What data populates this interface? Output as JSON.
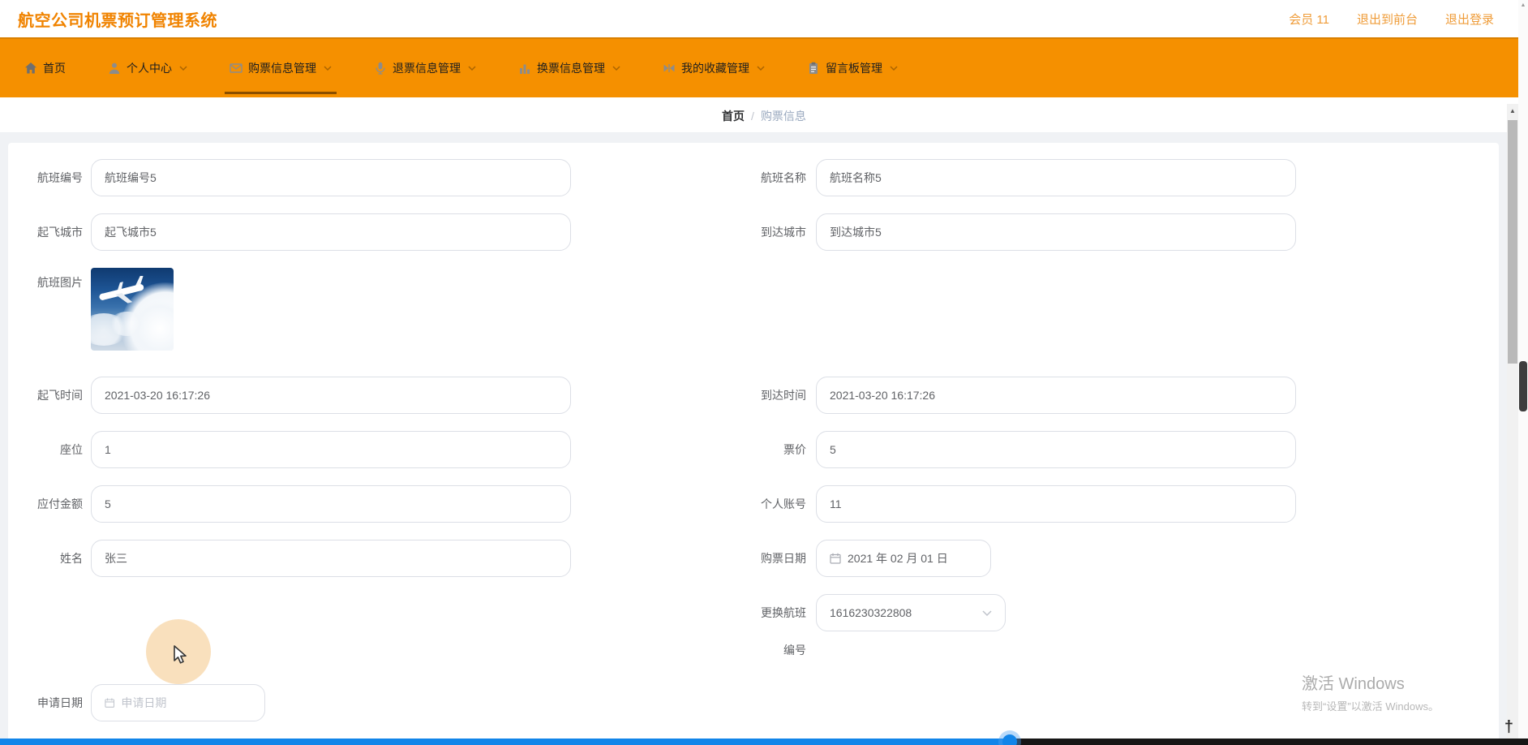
{
  "header": {
    "title": "航空公司机票预订管理系统",
    "member_label": "会员 11",
    "exit_front_label": "退出到前台",
    "logout_label": "退出登录"
  },
  "nav": {
    "items": [
      {
        "label": "首页",
        "icon": "home-icon",
        "active": false
      },
      {
        "label": "个人中心",
        "icon": "user-icon",
        "active": false
      },
      {
        "label": "购票信息管理",
        "icon": "mail-icon",
        "active": true
      },
      {
        "label": "退票信息管理",
        "icon": "mic-icon",
        "active": false
      },
      {
        "label": "换票信息管理",
        "icon": "bar-chart-icon",
        "active": false
      },
      {
        "label": "我的收藏管理",
        "icon": "collect-icon",
        "active": false
      },
      {
        "label": "留言板管理",
        "icon": "board-icon",
        "active": false
      }
    ]
  },
  "breadcrumb": {
    "home": "首页",
    "separator": "/",
    "current": "购票信息"
  },
  "form": {
    "flight_no": {
      "label": "航班编号",
      "value": "航班编号5"
    },
    "flight_name": {
      "label": "航班名称",
      "value": "航班名称5"
    },
    "depart_city": {
      "label": "起飞城市",
      "value": "起飞城市5"
    },
    "arrive_city": {
      "label": "到达城市",
      "value": "到达城市5"
    },
    "flight_image": {
      "label": "航班图片",
      "image": "airplane-photo"
    },
    "depart_time": {
      "label": "起飞时间",
      "value": "2021-03-20 16:17:26"
    },
    "arrive_time": {
      "label": "到达时间",
      "value": "2021-03-20 16:17:26"
    },
    "seat": {
      "label": "座位",
      "value": "1"
    },
    "price": {
      "label": "票价",
      "value": "5"
    },
    "amount": {
      "label": "应付金额",
      "value": "5"
    },
    "account": {
      "label": "个人账号",
      "value": "11"
    },
    "name": {
      "label": "姓名",
      "value": "张三"
    },
    "buy_date": {
      "label": "购票日期",
      "value": "2021 年 02 月 01 日"
    },
    "change_flight": {
      "label": "更换航班编号",
      "value": "1616230322808"
    },
    "apply_date": {
      "label": "申请日期",
      "placeholder": "申请日期"
    }
  },
  "watermark": {
    "line1": "激活 Windows",
    "line2": "转到“设置”以激活 Windows。"
  }
}
